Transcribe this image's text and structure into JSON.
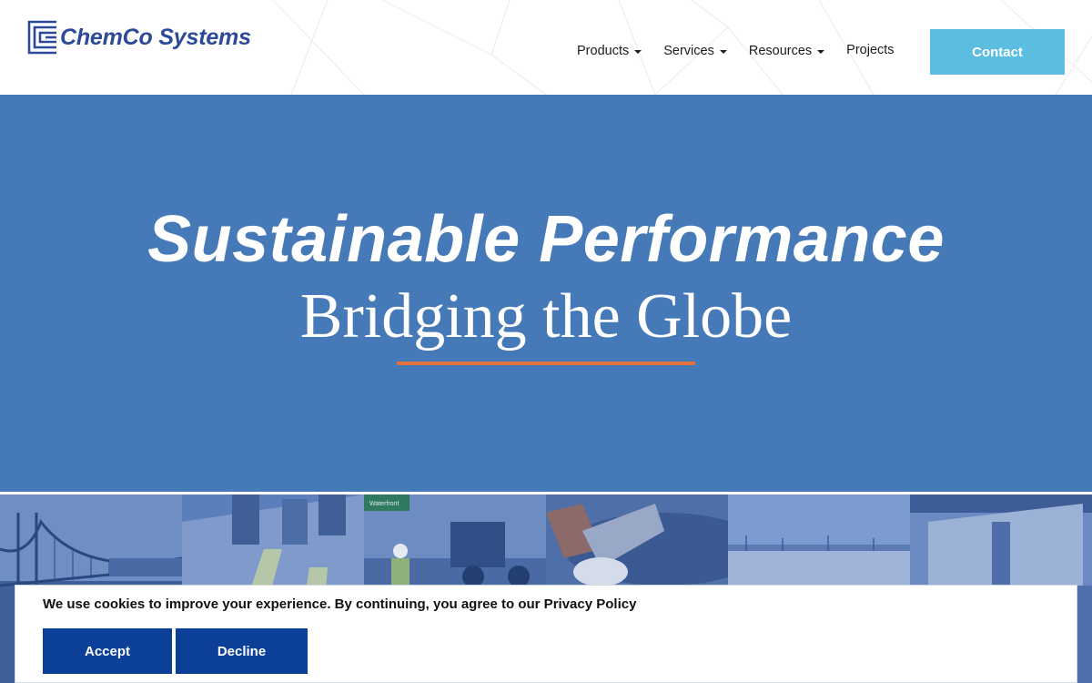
{
  "brand": {
    "name": "ChemCo Systems",
    "color": "#2d4a9a"
  },
  "nav": {
    "items": [
      {
        "label": "Products",
        "has_dropdown": true
      },
      {
        "label": "Services",
        "has_dropdown": true
      },
      {
        "label": "Resources",
        "has_dropdown": true
      },
      {
        "label": "Projects",
        "has_dropdown": false
      }
    ],
    "contact_label": "Contact"
  },
  "hero": {
    "title": "Sustainable Performance",
    "subtitle": "Bridging the Globe",
    "background": "#4679b8",
    "accent": "#e0703c"
  },
  "strip": {
    "tiles": [
      "bridge-photo",
      "workers-photo",
      "road-crew-photo",
      "pipe-photo",
      "construction-photo",
      "structure-photo"
    ],
    "sign_text": "Waterfront"
  },
  "cookie": {
    "message": "We use cookies to improve your experience. By continuing, you agree to our Privacy Policy",
    "accept_label": "Accept",
    "decline_label": "Decline",
    "button_color": "#0b3f98"
  }
}
